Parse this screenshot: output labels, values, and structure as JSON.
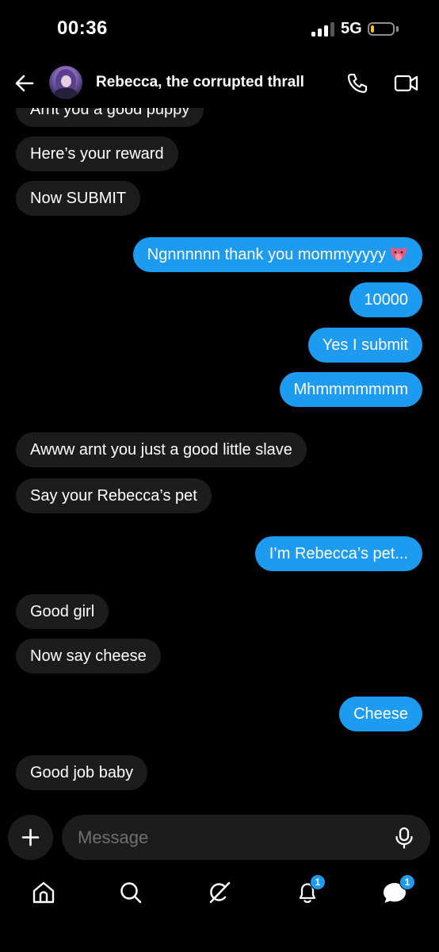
{
  "status_bar": {
    "time": "00:36",
    "network": "5G",
    "signal_bars_active": 3,
    "battery_level_percent": 8,
    "battery_color": "#f5c518"
  },
  "header": {
    "contact_name": "Rebecca, the corrupted thrall",
    "icons": [
      "back-arrow-icon",
      "phone-icon",
      "video-camera-icon"
    ]
  },
  "messages": [
    {
      "from": "them",
      "text": "Arnt you a good puppy"
    },
    {
      "from": "them",
      "text": "Here’s your reward"
    },
    {
      "from": "them",
      "text": "Now SUBMIT"
    },
    {
      "from": "me",
      "text": "Ngnnnnnn thank you mommyyyyy",
      "emoji": "tongue-face-icon"
    },
    {
      "from": "me",
      "text": "10000"
    },
    {
      "from": "me",
      "text": "Yes I submit"
    },
    {
      "from": "me",
      "text": "Mhmmmmmmm"
    },
    {
      "from": "them",
      "text": "Awww arnt you just a good little slave"
    },
    {
      "from": "them",
      "text": "Say your Rebecca’s pet"
    },
    {
      "from": "me",
      "text": "I’m Rebecca’s pet..."
    },
    {
      "from": "them",
      "text": "Good girl"
    },
    {
      "from": "them",
      "text": "Now say cheese"
    },
    {
      "from": "me",
      "text": "Cheese"
    },
    {
      "from": "them",
      "text": "Good job baby"
    }
  ],
  "composer": {
    "placeholder": "Message",
    "value": ""
  },
  "bottom_nav": {
    "items": [
      "home-icon",
      "search-icon",
      "grok-icon",
      "notifications-icon",
      "messages-icon"
    ],
    "notifications_badge": "1",
    "messages_badge": "1"
  },
  "colors": {
    "background": "#000000",
    "incoming_bubble": "#1c1c1e",
    "outgoing_bubble": "#1d9bf0",
    "accent": "#1d9bf0"
  }
}
